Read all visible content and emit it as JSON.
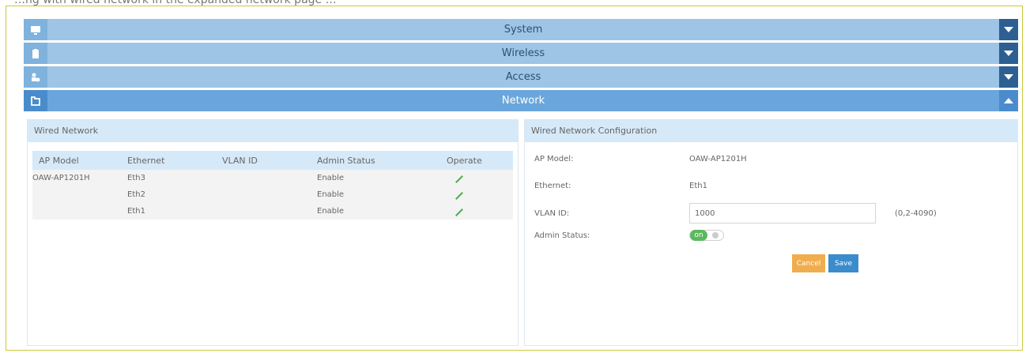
{
  "caption": "…ng with wired network in the expanded network page …",
  "accordion": {
    "items": [
      {
        "title": "System",
        "icon": "monitor-icon",
        "state": "collapsed"
      },
      {
        "title": "Wireless",
        "icon": "clipboard-icon",
        "state": "collapsed"
      },
      {
        "title": "Access",
        "icon": "users-icon",
        "state": "collapsed"
      },
      {
        "title": "Network",
        "icon": "network-icon",
        "state": "expanded"
      }
    ]
  },
  "wired": {
    "header": "Wired Network",
    "columns": [
      "AP Model",
      "Ethernet",
      "VLAN ID",
      "Admin Status",
      "Operate"
    ],
    "rows": [
      {
        "ap_model": "OAW-AP1201H",
        "ethernet": "Eth3",
        "vlan": "",
        "status": "Enable"
      },
      {
        "ap_model": "",
        "ethernet": "Eth2",
        "vlan": "",
        "status": "Enable"
      },
      {
        "ap_model": "",
        "ethernet": "Eth1",
        "vlan": "",
        "status": "Enable"
      }
    ]
  },
  "config": {
    "header": "Wired Network Configuration",
    "ap_model_label": "AP Model:",
    "ap_model_value": "OAW-AP1201H",
    "ethernet_label": "Ethernet:",
    "ethernet_value": "Eth1",
    "vlan_label": "VLAN ID:",
    "vlan_value": "1000",
    "vlan_hint": "(0,2-4090)",
    "admin_label": "Admin Status:",
    "admin_toggle": "on",
    "cancel_label": "Cancel",
    "save_label": "Save"
  },
  "colors": {
    "accordion_collapsed": "#9ec5e6",
    "accordion_active": "#6aa6dc",
    "toggle_dark": "#2e5f91",
    "cancel": "#f0ad4e",
    "save": "#3a8ccc",
    "on_green": "#5cb85c"
  }
}
